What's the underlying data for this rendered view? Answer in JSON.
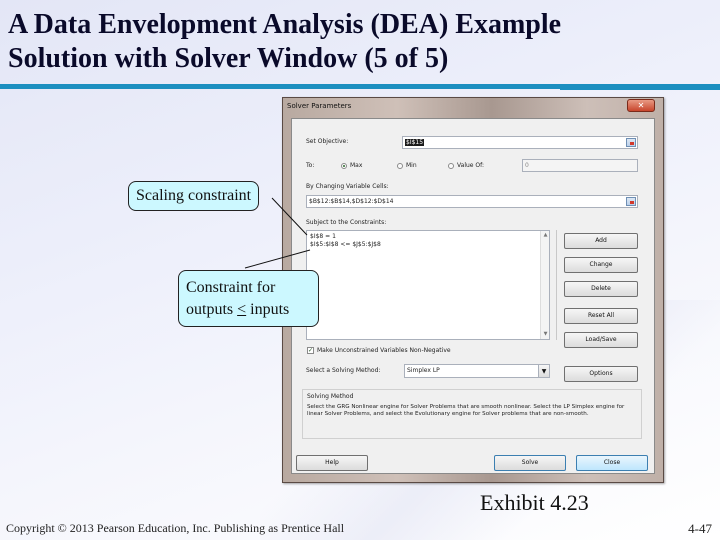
{
  "slide": {
    "title_line1": "A Data Envelopment Analysis (DEA) Example",
    "title_line2": "Solution with Solver Window (5 of 5)",
    "exhibit": "Exhibit 4.23",
    "copyright": "Copyright © 2013 Pearson Education, Inc. Publishing as Prentice Hall",
    "page_number": "4-47",
    "accent_color": "#1c8fc0"
  },
  "callouts": {
    "scaling": "Scaling constraint",
    "outputs_line1": "Constraint for",
    "outputs_prefix": "outputs ",
    "outputs_symbol": "<",
    "outputs_suffix": " inputs"
  },
  "dialog": {
    "title": "Solver Parameters",
    "close_icon": "close-icon",
    "set_objective_label": "Set Objective:",
    "set_objective_value": "$I$15",
    "to_label": "To:",
    "radio_max": "Max",
    "radio_min": "Min",
    "radio_value_of": "Value Of:",
    "value_of_value": "0",
    "selected_goal": "Max",
    "changing_cells_label": "By Changing Variable Cells:",
    "changing_cells_value": "$B$12:$B$14,$D$12:$D$14",
    "constraints_label": "Subject to the Constraints:",
    "constraints": [
      "$I$8 = 1",
      "$I$5:$I$8 <= $J$5:$J$8"
    ],
    "buttons": {
      "add": "Add",
      "change": "Change",
      "delete": "Delete",
      "reset_all": "Reset All",
      "load_save": "Load/Save",
      "options": "Options",
      "help": "Help",
      "solve": "Solve",
      "close": "Close"
    },
    "nonnegative_label": "Make Unconstrained Variables Non-Negative",
    "nonnegative_checked": true,
    "solving_method_label": "Select a Solving Method:",
    "solving_method_value": "Simplex LP",
    "solving_group_title": "Solving Method",
    "solving_group_text": "Select the GRG Nonlinear engine for Solver Problems that are smooth nonlinear. Select the LP Simplex engine for linear Solver Problems, and select the Evolutionary engine for Solver problems that are non-smooth."
  }
}
